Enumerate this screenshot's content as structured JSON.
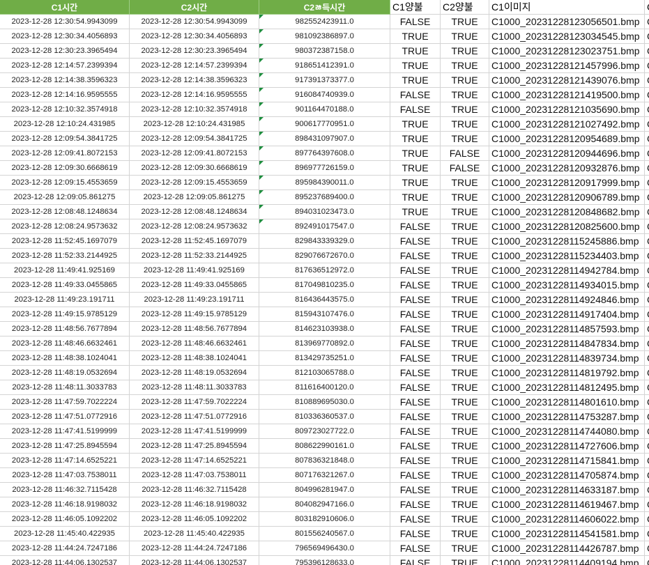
{
  "headers": [
    "C1시간",
    "C2시간",
    "C2ㅀ득시간",
    "C1양불",
    "C2양불",
    "C1이미지",
    "C"
  ],
  "rows": [
    [
      "2023-12-28 12:30:54.9943099",
      "2023-12-28 12:30:54.9943099",
      "982552423911.0",
      "FALSE",
      "TRUE",
      "C1000_20231228123056501.bmp",
      "C"
    ],
    [
      "2023-12-28 12:30:34.4056893",
      "2023-12-28 12:30:34.4056893",
      "981092386897.0",
      "TRUE",
      "TRUE",
      "C1000_20231228123034545.bmp",
      "C"
    ],
    [
      "2023-12-28 12:30:23.3965494",
      "2023-12-28 12:30:23.3965494",
      "980372387158.0",
      "TRUE",
      "TRUE",
      "C1000_20231228123023751.bmp",
      "C"
    ],
    [
      "2023-12-28 12:14:57.2399394",
      "2023-12-28 12:14:57.2399394",
      "918651412391.0",
      "TRUE",
      "TRUE",
      "C1000_20231228121457996.bmp",
      "C"
    ],
    [
      "2023-12-28 12:14:38.3596323",
      "2023-12-28 12:14:38.3596323",
      "917391373377.0",
      "TRUE",
      "TRUE",
      "C1000_20231228121439076.bmp",
      "C"
    ],
    [
      "2023-12-28 12:14:16.9595555",
      "2023-12-28 12:14:16.9595555",
      "916084740939.0",
      "FALSE",
      "TRUE",
      "C1000_20231228121419500.bmp",
      "C"
    ],
    [
      "2023-12-28 12:10:32.3574918",
      "2023-12-28 12:10:32.3574918",
      "901164470188.0",
      "FALSE",
      "TRUE",
      "C1000_20231228121035690.bmp",
      "C"
    ],
    [
      "2023-12-28 12:10:24.431985",
      "2023-12-28 12:10:24.431985",
      "900617770951.0",
      "TRUE",
      "TRUE",
      "C1000_20231228121027492.bmp",
      "C"
    ],
    [
      "2023-12-28 12:09:54.3841725",
      "2023-12-28 12:09:54.3841725",
      "898431097907.0",
      "TRUE",
      "TRUE",
      "C1000_20231228120954689.bmp",
      "C"
    ],
    [
      "2023-12-28 12:09:41.8072153",
      "2023-12-28 12:09:41.8072153",
      "897764397608.0",
      "TRUE",
      "FALSE",
      "C1000_20231228120944696.bmp",
      "C"
    ],
    [
      "2023-12-28 12:09:30.6668619",
      "2023-12-28 12:09:30.6668619",
      "896977726159.0",
      "TRUE",
      "FALSE",
      "C1000_20231228120932876.bmp",
      "C"
    ],
    [
      "2023-12-28 12:09:15.4553659",
      "2023-12-28 12:09:15.4553659",
      "895984390011.0",
      "TRUE",
      "TRUE",
      "C1000_20231228120917999.bmp",
      "C"
    ],
    [
      "2023-12-28 12:09:05.861275",
      "2023-12-28 12:09:05.861275",
      "895237689400.0",
      "TRUE",
      "TRUE",
      "C1000_20231228120906789.bmp",
      "C"
    ],
    [
      "2023-12-28 12:08:48.1248634",
      "2023-12-28 12:08:48.1248634",
      "894031023473.0",
      "TRUE",
      "TRUE",
      "C1000_20231228120848682.bmp",
      "C"
    ],
    [
      "2023-12-28 12:08:24.9573632",
      "2023-12-28 12:08:24.9573632",
      "892491017547.0",
      "FALSE",
      "TRUE",
      "C1000_20231228120825600.bmp",
      "C"
    ],
    [
      "2023-12-28 11:52:45.1697079",
      "2023-12-28 11:52:45.1697079",
      "829843339329.0",
      "FALSE",
      "TRUE",
      "C1000_20231228115245886.bmp",
      "C"
    ],
    [
      "2023-12-28 11:52:33.2144925",
      "2023-12-28 11:52:33.2144925",
      "829076672670.0",
      "FALSE",
      "TRUE",
      "C1000_20231228115234403.bmp",
      "C"
    ],
    [
      "2023-12-28 11:49:41.925169",
      "2023-12-28 11:49:41.925169",
      "817636512972.0",
      "FALSE",
      "TRUE",
      "C1000_20231228114942784.bmp",
      "C"
    ],
    [
      "2023-12-28 11:49:33.0455865",
      "2023-12-28 11:49:33.0455865",
      "817049810235.0",
      "FALSE",
      "TRUE",
      "C1000_20231228114934015.bmp",
      "C"
    ],
    [
      "2023-12-28 11:49:23.191711",
      "2023-12-28 11:49:23.191711",
      "816436443575.0",
      "FALSE",
      "TRUE",
      "C1000_20231228114924846.bmp",
      "C"
    ],
    [
      "2023-12-28 11:49:15.9785129",
      "2023-12-28 11:49:15.9785129",
      "815943107476.0",
      "FALSE",
      "TRUE",
      "C1000_20231228114917404.bmp",
      "C"
    ],
    [
      "2023-12-28 11:48:56.7677894",
      "2023-12-28 11:48:56.7677894",
      "814623103938.0",
      "FALSE",
      "TRUE",
      "C1000_20231228114857593.bmp",
      "C"
    ],
    [
      "2023-12-28 11:48:46.6632461",
      "2023-12-28 11:48:46.6632461",
      "813969770892.0",
      "FALSE",
      "TRUE",
      "C1000_20231228114847834.bmp",
      "C"
    ],
    [
      "2023-12-28 11:48:38.1024041",
      "2023-12-28 11:48:38.1024041",
      "813429735251.0",
      "FALSE",
      "TRUE",
      "C1000_20231228114839734.bmp",
      "C"
    ],
    [
      "2023-12-28 11:48:19.0532694",
      "2023-12-28 11:48:19.0532694",
      "812103065788.0",
      "FALSE",
      "TRUE",
      "C1000_20231228114819792.bmp",
      "C"
    ],
    [
      "2023-12-28 11:48:11.3033783",
      "2023-12-28 11:48:11.3033783",
      "811616400120.0",
      "FALSE",
      "TRUE",
      "C1000_20231228114812495.bmp",
      "C"
    ],
    [
      "2023-12-28 11:47:59.7022224",
      "2023-12-28 11:47:59.7022224",
      "810889695030.0",
      "FALSE",
      "TRUE",
      "C1000_20231228114801610.bmp",
      "C"
    ],
    [
      "2023-12-28 11:47:51.0772916",
      "2023-12-28 11:47:51.0772916",
      "810336360537.0",
      "FALSE",
      "TRUE",
      "C1000_20231228114753287.bmp",
      "C"
    ],
    [
      "2023-12-28 11:47:41.5199999",
      "2023-12-28 11:47:41.5199999",
      "809723027722.0",
      "FALSE",
      "TRUE",
      "C1000_20231228114744080.bmp",
      "C"
    ],
    [
      "2023-12-28 11:47:25.8945594",
      "2023-12-28 11:47:25.8945594",
      "808622990161.0",
      "FALSE",
      "TRUE",
      "C1000_20231228114727606.bmp",
      "C"
    ],
    [
      "2023-12-28 11:47:14.6525221",
      "2023-12-28 11:47:14.6525221",
      "807836321848.0",
      "FALSE",
      "TRUE",
      "C1000_20231228114715841.bmp",
      "C"
    ],
    [
      "2023-12-28 11:47:03.7538011",
      "2023-12-28 11:47:03.7538011",
      "807176321267.0",
      "FALSE",
      "TRUE",
      "C1000_20231228114705874.bmp",
      "C"
    ],
    [
      "2023-12-28 11:46:32.7115428",
      "2023-12-28 11:46:32.7115428",
      "804996281947.0",
      "FALSE",
      "TRUE",
      "C1000_20231228114633187.bmp",
      "C"
    ],
    [
      "2023-12-28 11:46:18.9198032",
      "2023-12-28 11:46:18.9198032",
      "804082947166.0",
      "FALSE",
      "TRUE",
      "C1000_20231228114619467.bmp",
      "C"
    ],
    [
      "2023-12-28 11:46:05.1092202",
      "2023-12-28 11:46:05.1092202",
      "803182910606.0",
      "FALSE",
      "TRUE",
      "C1000_20231228114606022.bmp",
      "C"
    ],
    [
      "2023-12-28 11:45:40.422935",
      "2023-12-28 11:45:40.422935",
      "801556240567.0",
      "FALSE",
      "TRUE",
      "C1000_20231228114541581.bmp",
      "C"
    ],
    [
      "2023-12-28 11:44:24.7247186",
      "2023-12-28 11:44:24.7247186",
      "796569496430.0",
      "FALSE",
      "TRUE",
      "C1000_20231228114426787.bmp",
      "C"
    ],
    [
      "2023-12-28 11:44:06.1302537",
      "2023-12-28 11:44:06.1302537",
      "795396128633.0",
      "FALSE",
      "TRUE",
      "C1000_20231228114409194.bmp",
      "C"
    ]
  ],
  "flagged_rows": [
    0,
    1,
    2,
    3,
    4,
    5,
    6,
    7,
    8,
    9,
    10,
    11,
    12,
    13,
    14
  ],
  "colors": {
    "header_green": "#70ad47",
    "flag_green": "#1e8e3e",
    "grid": "#d4d4d4"
  }
}
